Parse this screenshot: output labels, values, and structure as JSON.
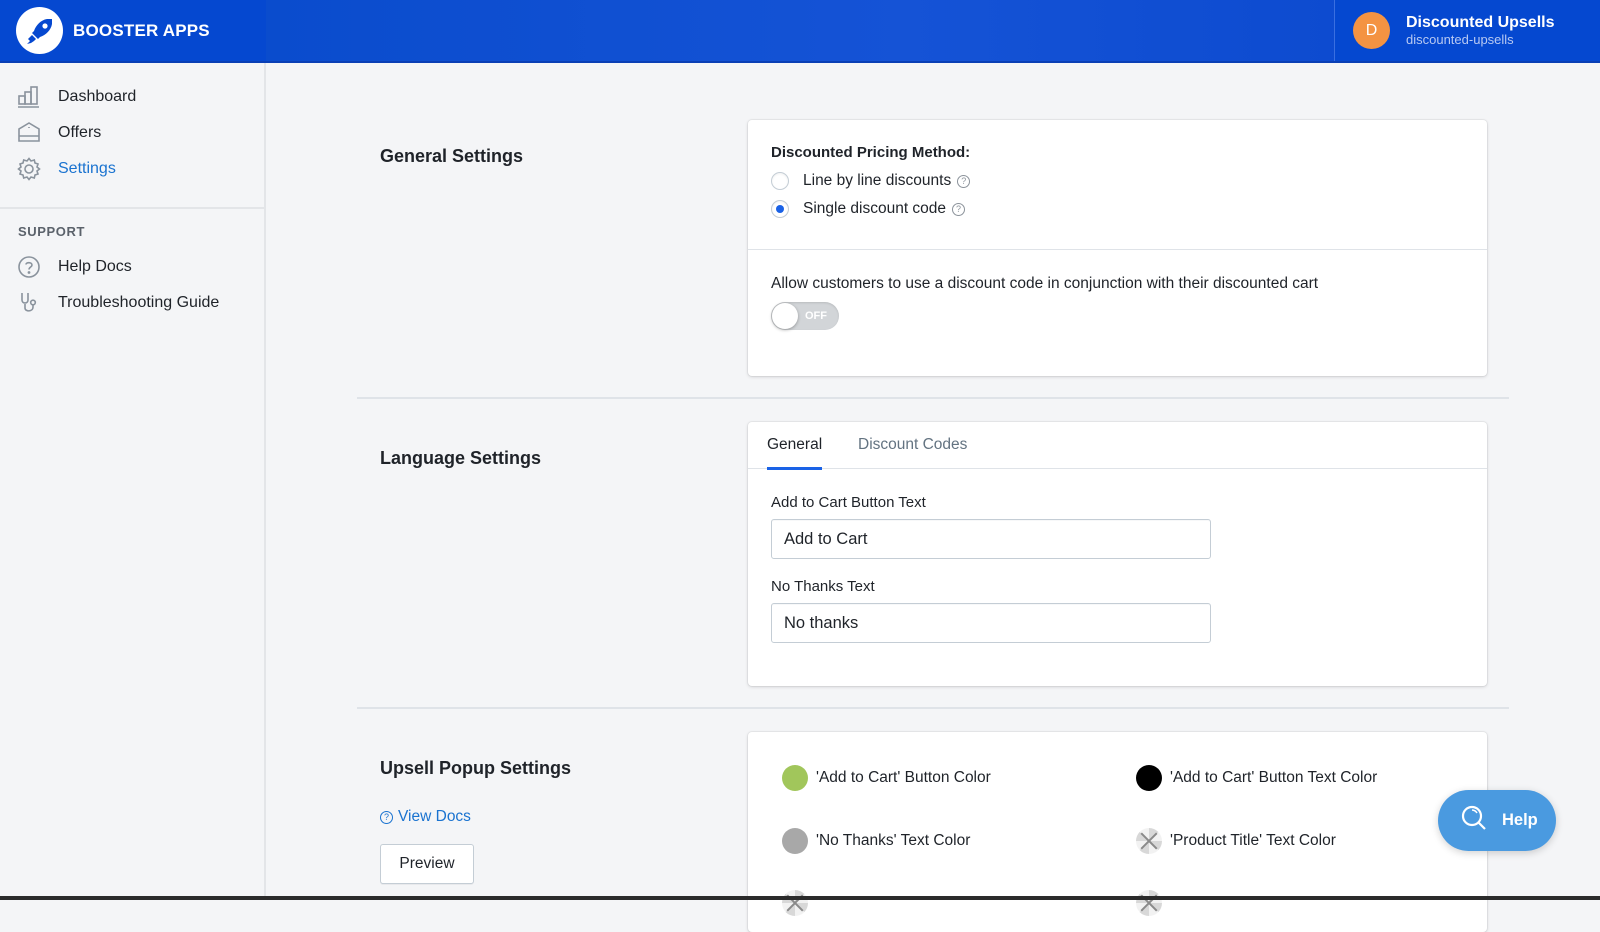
{
  "header": {
    "brand": "BOOSTER APPS",
    "brand_icon": "rocket-icon",
    "account": {
      "avatar_initial": "D",
      "avatar_color": "#f49342",
      "name": "Discounted Upsells",
      "handle": "discounted-upsells"
    }
  },
  "sidebar": {
    "items": [
      {
        "label": "Dashboard",
        "icon": "bar-chart-icon",
        "active": false
      },
      {
        "label": "Offers",
        "icon": "tag-icon",
        "active": false
      },
      {
        "label": "Settings",
        "icon": "gear-icon",
        "active": true
      }
    ],
    "support_heading": "SUPPORT",
    "support_items": [
      {
        "label": "Help Docs",
        "icon": "question-circle-icon"
      },
      {
        "label": "Troubleshooting Guide",
        "icon": "stethoscope-icon"
      }
    ]
  },
  "general_settings": {
    "title": "General Settings",
    "pricing_method_label": "Discounted Pricing Method:",
    "options": [
      {
        "label": "Line by line discounts",
        "checked": false
      },
      {
        "label": "Single discount code",
        "checked": true
      }
    ],
    "allow_codes_label": "Allow customers to use a discount code in conjunction with their discounted cart",
    "allow_codes_toggle": "OFF"
  },
  "language_settings": {
    "title": "Language Settings",
    "tabs": [
      {
        "label": "General",
        "active": true
      },
      {
        "label": "Discount Codes",
        "active": false
      }
    ],
    "fields": [
      {
        "label": "Add to Cart Button Text",
        "value": "Add to Cart"
      },
      {
        "label": "No Thanks Text",
        "value": "No thanks"
      }
    ]
  },
  "upsell_popup_settings": {
    "title": "Upsell Popup Settings",
    "view_docs": "View Docs",
    "preview_button": "Preview",
    "colors": [
      {
        "label": "'Add to Cart' Button Color",
        "color": "#a1c65b"
      },
      {
        "label": "'Add to Cart' Button Text Color",
        "color": "#000000"
      },
      {
        "label": "'No Thanks' Text Color",
        "color": "#a8a8a8"
      },
      {
        "label": "'Product Title' Text Color",
        "color": "transparent"
      }
    ]
  },
  "help_button": {
    "label": "Help",
    "color": "#4a9ae0"
  },
  "colors": {
    "header_blue": "#0548d0",
    "accent_link": "#1a73d0",
    "tab_underline": "#1a62e6"
  }
}
